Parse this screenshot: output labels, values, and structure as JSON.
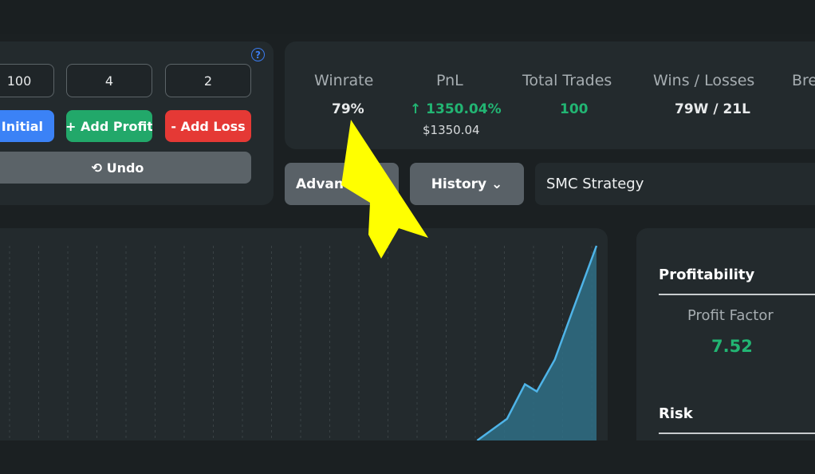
{
  "controls": {
    "inputs": [
      "100",
      "4",
      "2"
    ],
    "set_initial_label": "Set Initial",
    "add_profit_label": "+ Add Profit",
    "add_loss_label": "- Add Loss",
    "undo_label": "⟲ Undo",
    "help_label": "?"
  },
  "stats": {
    "winrate_label": "Winrate",
    "winrate_value": "79%",
    "pnl_label": "PnL",
    "pnl_value": "↑ 1350.04%",
    "pnl_amount": "$1350.04",
    "total_trades_label": "Total Trades",
    "total_trades_value": "100",
    "wins_losses_label": "Wins / Losses",
    "wins_losses_value": "79W / 21L",
    "breakeven_label": "Breakeven"
  },
  "toolbar": {
    "advanced_label": "Advanced",
    "history_label": "History ⌄",
    "strategy_name": "SMC Strategy"
  },
  "metrics": {
    "profitability_heading": "Profitability",
    "profit_factor_label": "Profit Factor",
    "profit_factor_value": "7.52",
    "risk_heading": "Risk"
  },
  "colors": {
    "accent_blue": "#3b82f6",
    "profit_green": "#22b573",
    "loss_red": "#e53935",
    "annotation_yellow": "#ffff00"
  },
  "chart_data": {
    "type": "area",
    "series": [
      {
        "x": [
          0,
          10,
          20,
          30,
          40,
          50,
          60,
          70,
          80,
          85,
          88,
          90,
          93,
          96,
          100
        ],
        "values": [
          0,
          0,
          0,
          0,
          0,
          0,
          0,
          0,
          0,
          150,
          390,
          340,
          560,
          900,
          1350
        ]
      }
    ],
    "grid": true
  }
}
